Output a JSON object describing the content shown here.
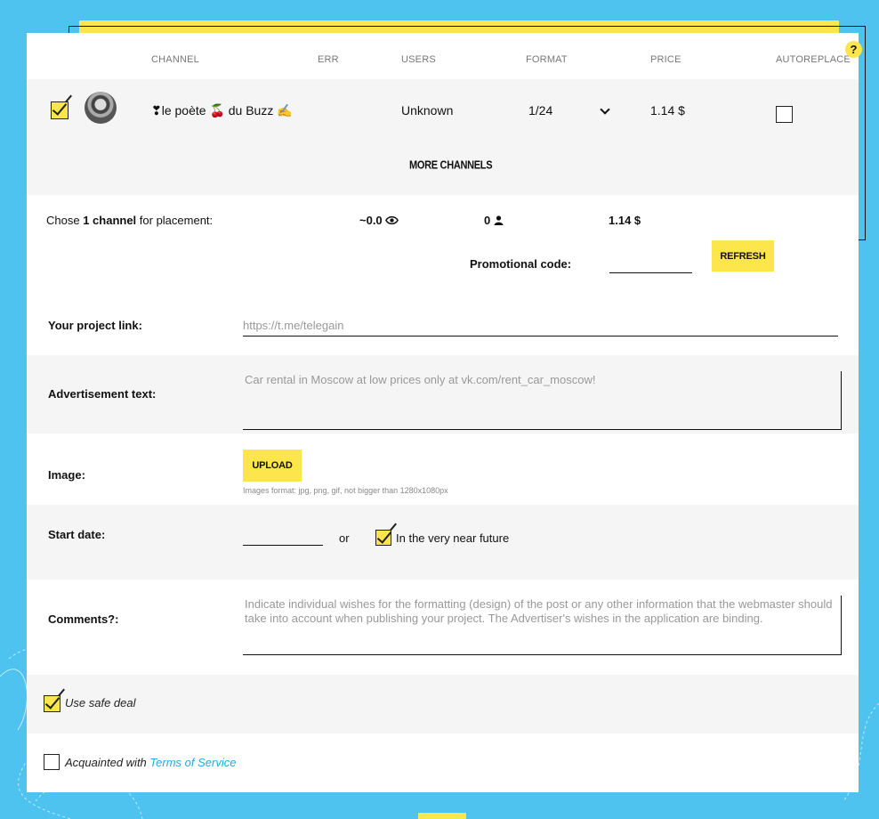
{
  "table": {
    "headers": {
      "channel": "CHANNEL",
      "err": "ERR",
      "users": "USERS",
      "format": "FORMAT",
      "price": "PRICE",
      "autoreplace": "AUTOREPLACE"
    },
    "help_badge": "?",
    "row": {
      "selected": true,
      "channel_name": "❣le poète 🍒 du Buzz ✍",
      "users": "Unknown",
      "format": "1/24",
      "price": "1.14 $",
      "autoreplace": false
    },
    "more_channels": "MORE CHANNELS"
  },
  "summary": {
    "chose_prefix": "Chose ",
    "chose_count": "1 channel",
    "chose_suffix": " for placement:",
    "views": "~0.0",
    "subscribers": "0",
    "total": "1.14 $"
  },
  "promo": {
    "label": "Promotional code:",
    "value": "",
    "refresh_label": "REFRESH"
  },
  "form": {
    "project_link_label": "Your project link:",
    "project_link_placeholder": "https://t.me/telegain",
    "ad_text_label": "Advertisement text:",
    "ad_text_placeholder": "Car rental in Moscow at low prices only at vk.com/rent_car_moscow!",
    "image_label": "Image:",
    "upload_label": "UPLOAD",
    "image_note": "Images format: jpg, png, gif, not bigger than 1280x1080px",
    "start_date_label": "Start date:",
    "start_date_value": "",
    "or_text": "or",
    "near_future_label": "In the very near future",
    "near_future_checked": true,
    "comments_label": "Comments?:",
    "comments_placeholder": "Indicate individual wishes for the formatting (design) of the post or any other information that the webmaster should take into account when publishing your project. The Advertiser's wishes in the application are binding.",
    "safe_deal_label": "Use safe deal",
    "safe_deal_checked": true,
    "terms_prefix": "Acquainted with ",
    "terms_link": "Terms of Service",
    "terms_checked": false
  },
  "colors": {
    "background": "#4ec3f0",
    "accent_yellow": "#fce64b",
    "link": "#29a8dc"
  }
}
